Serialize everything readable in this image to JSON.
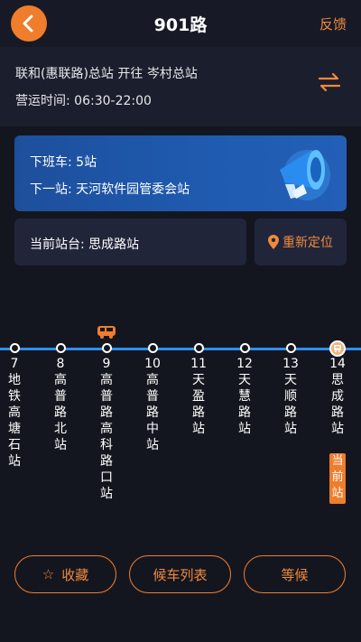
{
  "header": {
    "title": "901路",
    "feedback_label": "反馈",
    "back_icon": "chevron-left-icon"
  },
  "route": {
    "direction": "联和(惠联路)总站 开往 岑村总站",
    "service_hours": "营运时间: 06:30-22:00",
    "swap_icon": "swap-direction-icon"
  },
  "next_bus": {
    "next_bus_label": "下班车: 5站",
    "next_station_label": "下一站: 天河软件园管委会站",
    "icon": "megaphone-icon"
  },
  "current": {
    "label": "当前站台: 思成路站",
    "relocate_label": "重新定位",
    "relocate_icon": "location-pin-icon"
  },
  "stops": [
    {
      "num": "7",
      "name": "地铁高塘石站"
    },
    {
      "num": "8",
      "name": "高普路北站"
    },
    {
      "num": "9",
      "name": "高普路高科路口站"
    },
    {
      "num": "10",
      "name": "高普路中站"
    },
    {
      "num": "11",
      "name": "天盈路站"
    },
    {
      "num": "12",
      "name": "天慧路站"
    },
    {
      "num": "13",
      "name": "天顺路站"
    },
    {
      "num": "14",
      "name": "思成路站"
    }
  ],
  "current_stop_tag": "当前站",
  "buttons": {
    "favorite_label": "收藏",
    "favorite_icon": "star-outline-icon",
    "timetable_label": "候车列表",
    "wait_label": "等候"
  },
  "colors": {
    "accent": "#ef7d2c",
    "route_line": "#2f8ef0",
    "card_blue": "#1f5bb0",
    "background": "#14161f"
  }
}
